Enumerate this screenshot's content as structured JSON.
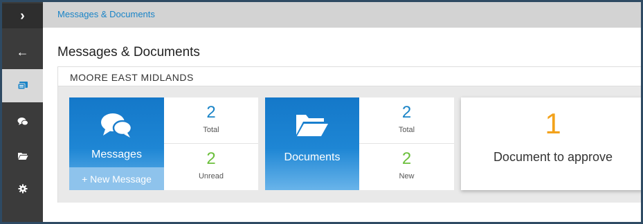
{
  "breadcrumb": "Messages & Documents",
  "page_title": "Messages & Documents",
  "organisation": "MOORE EAST MIDLANDS",
  "sidebar": {
    "items": [
      {
        "icon": "chevron-right-icon",
        "glyph": "›"
      },
      {
        "icon": "arrow-left-icon",
        "glyph": "←"
      },
      {
        "icon": "messages-documents-icon"
      },
      {
        "icon": "chat-icon"
      },
      {
        "icon": "folder-icon"
      },
      {
        "icon": "gear-icon"
      }
    ]
  },
  "messages_tile": {
    "label": "Messages",
    "new_button": "+ New Message",
    "total": "2",
    "total_label": "Total",
    "unread": "2",
    "unread_label": "Unread"
  },
  "documents_tile": {
    "label": "Documents",
    "total": "2",
    "total_label": "Total",
    "new": "2",
    "new_label": "New"
  },
  "approve_card": {
    "count": "1",
    "label": "Document to approve"
  },
  "colors": {
    "accent_blue": "#1a84c7",
    "green": "#6bbf3b",
    "orange": "#f3a21b",
    "sidebar": "#3b3b3b"
  }
}
